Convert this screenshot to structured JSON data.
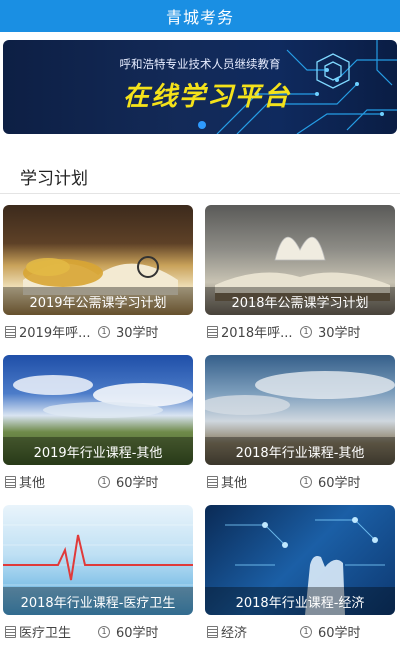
{
  "app": {
    "title": "青城考务"
  },
  "banner": {
    "subtitle": "呼和浩特专业技术人员继续教育",
    "headline": "在线学习平台"
  },
  "section": {
    "title": "学习计划"
  },
  "cards": [
    {
      "caption": "2019年公需课学习计划",
      "category": "2019年呼...",
      "hours": "30学时"
    },
    {
      "caption": "2018年公需课学习计划",
      "category": "2018年呼...",
      "hours": "30学时"
    },
    {
      "caption": "2019年行业课程-其他",
      "category": "其他",
      "hours": "60学时"
    },
    {
      "caption": "2018年行业课程-其他",
      "category": "其他",
      "hours": "60学时"
    },
    {
      "caption": "2018年行业课程-医疗卫生",
      "category": "医疗卫生",
      "hours": "60学时"
    },
    {
      "caption": "2018年行业课程-经济",
      "category": "经济",
      "hours": "60学时"
    }
  ]
}
